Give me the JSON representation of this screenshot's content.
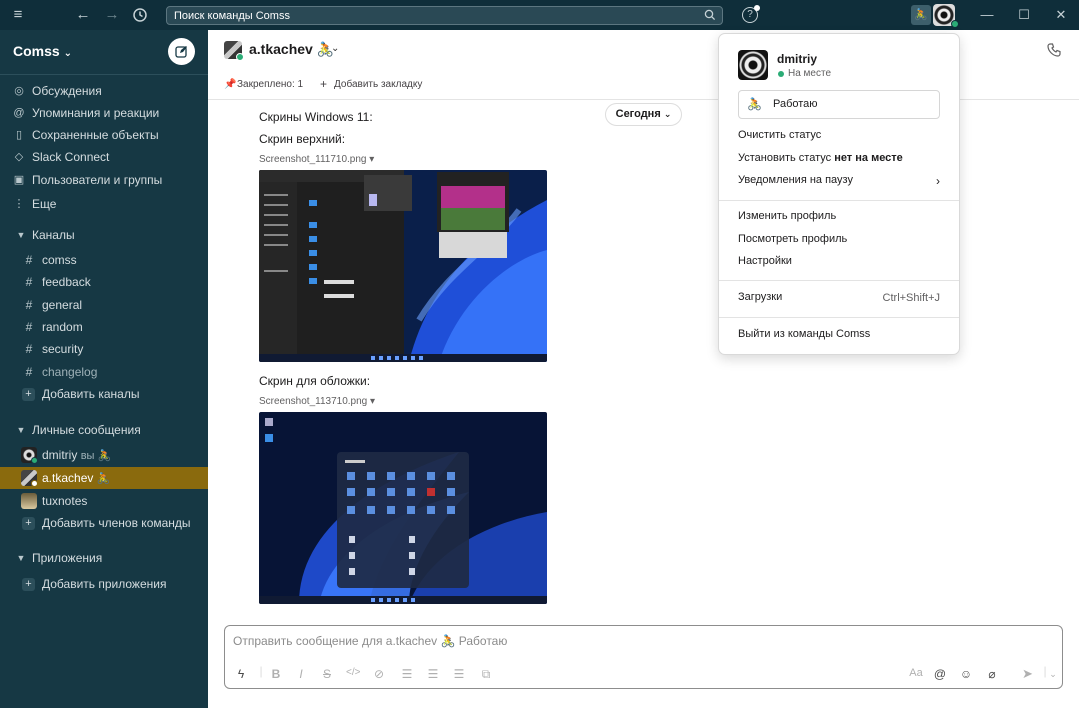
{
  "topbar": {
    "search_placeholder": "Поиск команды Comss",
    "help_label": "?"
  },
  "sidebar": {
    "workspace": "Comss",
    "nav": [
      {
        "label": "Обсуждения",
        "icon": "threads-icon"
      },
      {
        "label": "Упоминания и реакции",
        "icon": "at-icon"
      },
      {
        "label": "Сохраненные объекты",
        "icon": "bookmark-icon"
      },
      {
        "label": "Slack Connect",
        "icon": "connect-icon"
      },
      {
        "label": "Пользователи и группы",
        "icon": "people-icon"
      },
      {
        "label": "Еще",
        "icon": "more-icon"
      }
    ],
    "channels_header": "Каналы",
    "channels": [
      {
        "name": "comss"
      },
      {
        "name": "feedback"
      },
      {
        "name": "general"
      },
      {
        "name": "random"
      },
      {
        "name": "security"
      },
      {
        "name": "changelog"
      }
    ],
    "add_channels": "Добавить каналы",
    "dm_header": "Личные сообщения",
    "dms": [
      {
        "name": "dmitriy",
        "suffix": "вы 🚴"
      },
      {
        "name": "a.tkachev",
        "suffix": "🚴"
      },
      {
        "name": "tuxnotes",
        "suffix": ""
      }
    ],
    "add_members": "Добавить членов команды",
    "apps_header": "Приложения",
    "add_apps": "Добавить приложения"
  },
  "channel": {
    "title": "a.tkachev 🚴",
    "pinned": "Закреплено: 1",
    "add_bookmark": "Добавить закладку"
  },
  "messages": {
    "date_divider": "Сегодня",
    "line1": "Скрины Windows 11:",
    "line2": "Скрин верхний:",
    "file1": "Screenshot_111710.png",
    "line3": "Скрин для обложки:",
    "file2": "Screenshot_113710.png"
  },
  "composer": {
    "placeholder": "Отправить сообщение для a.tkachev 🚴 Работаю",
    "format_font": "Aa"
  },
  "popover": {
    "name": "dmitriy",
    "presence": "На месте",
    "status_emoji": "🚴",
    "status_text": "Работаю",
    "clear_status": "Очистить статус",
    "set_away_prefix": "Установить статус ",
    "set_away_bold": "нет на месте",
    "pause_notifications": "Уведомления на паузу",
    "edit_profile": "Изменить профиль",
    "view_profile": "Посмотреть профиль",
    "settings": "Настройки",
    "downloads": "Загрузки",
    "downloads_shortcut": "Ctrl+Shift+J",
    "sign_out": "Выйти из команды Comss"
  },
  "colors": {
    "topbar": "#0f2e3a",
    "sidebar": "#163844",
    "active_item": "#8a6a0d",
    "presence": "#2bac76"
  }
}
